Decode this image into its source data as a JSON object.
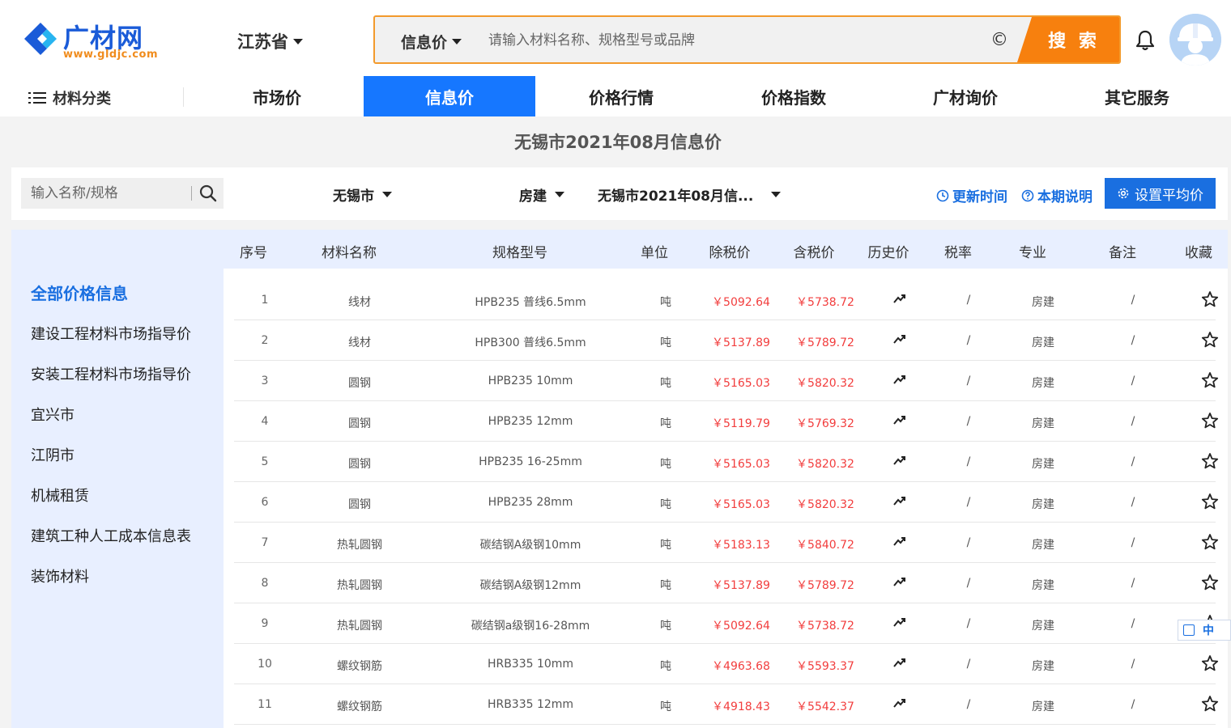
{
  "header": {
    "logo_text": "广材网",
    "logo_url": "www.gldjc.com",
    "province": "江苏省",
    "search_type": "信息价",
    "search_placeholder": "请输入材料名称、规格型号或品牌",
    "copy_glyph": "©",
    "search_button": "搜 索"
  },
  "nav": {
    "category": "材料分类",
    "items": [
      {
        "label": "市场价"
      },
      {
        "label": "信息价"
      },
      {
        "label": "价格行情"
      },
      {
        "label": "价格指数"
      },
      {
        "label": "广材询价"
      },
      {
        "label": "其它服务"
      }
    ],
    "active_index": 1
  },
  "page_title": "无锡市2021年08月信息价",
  "filters": {
    "search_placeholder": "输入名称/规格",
    "city": "无锡市",
    "profession": "房建",
    "period": "无锡市2021年08月信...",
    "update_time": "更新时间",
    "period_note": "本期说明",
    "set_avg_button": "设置平均价"
  },
  "sidebar": {
    "items": [
      {
        "label": "全部价格信息"
      },
      {
        "label": "建设工程材料市场指导价"
      },
      {
        "label": "安装工程材料市场指导价"
      },
      {
        "label": "宜兴市"
      },
      {
        "label": "江阴市"
      },
      {
        "label": "机械租赁"
      },
      {
        "label": "建筑工种人工成本信息表"
      },
      {
        "label": "装饰材料"
      }
    ],
    "active_index": 0
  },
  "table": {
    "headers": [
      "序号",
      "材料名称",
      "规格型号",
      "单位",
      "除税价",
      "含税价",
      "历史价",
      "税率",
      "专业",
      "备注",
      "收藏"
    ],
    "rows": [
      {
        "seq": "1",
        "name": "线材",
        "spec": "HPB235 普线6.5mm",
        "unit": "吨",
        "ex_tax": "￥5092.64",
        "inc_tax": "￥5738.72",
        "rate": "/",
        "prof": "房建",
        "note": "/"
      },
      {
        "seq": "2",
        "name": "线材",
        "spec": "HPB300 普线6.5mm",
        "unit": "吨",
        "ex_tax": "￥5137.89",
        "inc_tax": "￥5789.72",
        "rate": "/",
        "prof": "房建",
        "note": "/"
      },
      {
        "seq": "3",
        "name": "圆钢",
        "spec": "HPB235 10mm",
        "unit": "吨",
        "ex_tax": "￥5165.03",
        "inc_tax": "￥5820.32",
        "rate": "/",
        "prof": "房建",
        "note": "/"
      },
      {
        "seq": "4",
        "name": "圆钢",
        "spec": "HPB235 12mm",
        "unit": "吨",
        "ex_tax": "￥5119.79",
        "inc_tax": "￥5769.32",
        "rate": "/",
        "prof": "房建",
        "note": "/"
      },
      {
        "seq": "5",
        "name": "圆钢",
        "spec": "HPB235 16-25mm",
        "unit": "吨",
        "ex_tax": "￥5165.03",
        "inc_tax": "￥5820.32",
        "rate": "/",
        "prof": "房建",
        "note": "/"
      },
      {
        "seq": "6",
        "name": "圆钢",
        "spec": "HPB235 28mm",
        "unit": "吨",
        "ex_tax": "￥5165.03",
        "inc_tax": "￥5820.32",
        "rate": "/",
        "prof": "房建",
        "note": "/"
      },
      {
        "seq": "7",
        "name": "热轧圆钢",
        "spec": "碳结钢A级钢10mm",
        "unit": "吨",
        "ex_tax": "￥5183.13",
        "inc_tax": "￥5840.72",
        "rate": "/",
        "prof": "房建",
        "note": "/"
      },
      {
        "seq": "8",
        "name": "热轧圆钢",
        "spec": "碳结钢A级钢12mm",
        "unit": "吨",
        "ex_tax": "￥5137.89",
        "inc_tax": "￥5789.72",
        "rate": "/",
        "prof": "房建",
        "note": "/"
      },
      {
        "seq": "9",
        "name": "热轧圆钢",
        "spec": "碳结钢a级钢16-28mm",
        "unit": "吨",
        "ex_tax": "￥5092.64",
        "inc_tax": "￥5738.72",
        "rate": "/",
        "prof": "房建",
        "note": "/"
      },
      {
        "seq": "10",
        "name": "螺纹钢筋",
        "spec": "HRB335 10mm",
        "unit": "吨",
        "ex_tax": "￥4963.68",
        "inc_tax": "￥5593.37",
        "rate": "/",
        "prof": "房建",
        "note": "/"
      },
      {
        "seq": "11",
        "name": "螺纹钢筋",
        "spec": "HRB335 12mm",
        "unit": "吨",
        "ex_tax": "￥4918.43",
        "inc_tax": "￥5542.37",
        "rate": "/",
        "prof": "房建",
        "note": "/"
      }
    ]
  },
  "ime": {
    "label": "中"
  },
  "colors": {
    "brand_blue": "#1677ff",
    "accent_orange": "#f7800e",
    "price_red": "#f23d3d",
    "sidebar_bg": "#e8efff"
  }
}
